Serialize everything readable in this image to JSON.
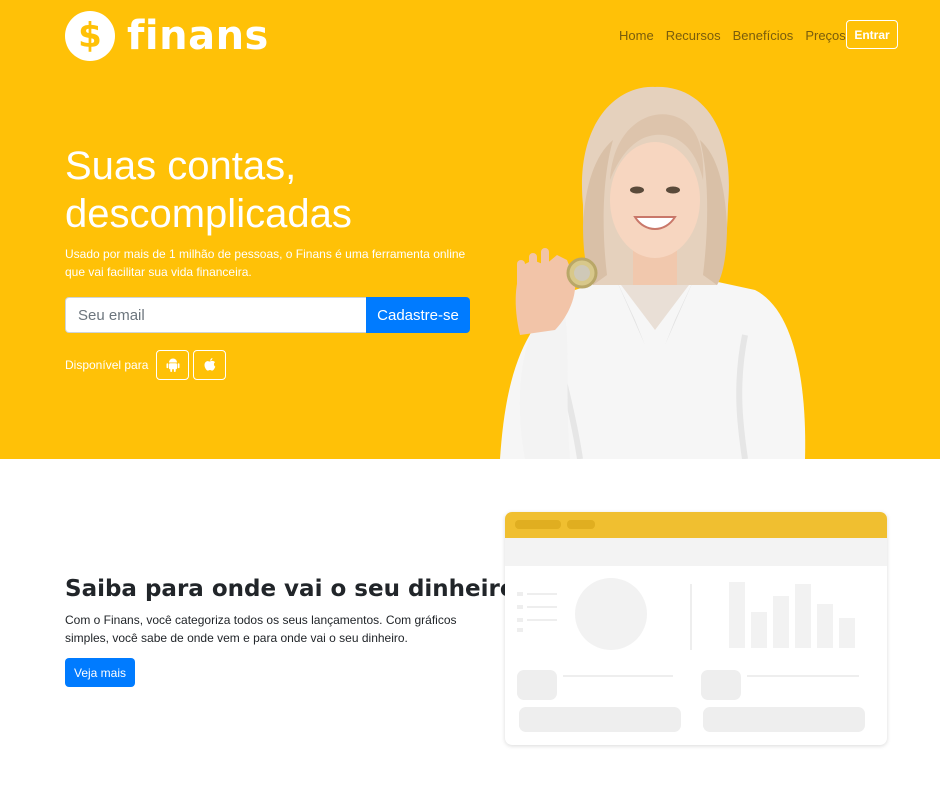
{
  "brand": {
    "logo_symbol": "$",
    "name": "finans"
  },
  "nav": {
    "items": [
      "Home",
      "Recursos",
      "Benefícios",
      "Preços"
    ],
    "login_label": "Entrar"
  },
  "hero": {
    "title": "Suas contas, descomplicadas",
    "subtitle": "Usado por mais de 1 milhão de pessoas, o Finans é uma ferramenta online que vai facilitar sua vida financeira.",
    "email_placeholder": "Seu email",
    "signup_label": "Cadastre-se",
    "available_label": "Disponível para",
    "platforms": [
      "android-icon",
      "apple-icon"
    ]
  },
  "feature": {
    "title": "Saiba para onde vai o seu dinheiro",
    "text": "Com o Finans, você categoriza todos os seus lançamentos. Com gráficos simples, você sabe de onde vem e para onde vai o seu dinheiro.",
    "cta_label": "Veja mais"
  },
  "colors": {
    "brand_yellow": "#ffc107",
    "primary_blue": "#007bff",
    "mock_header": "#f0bf30"
  }
}
